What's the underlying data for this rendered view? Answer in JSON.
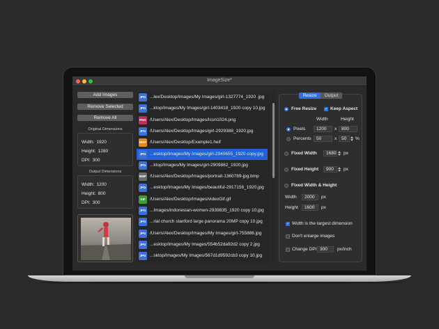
{
  "window": {
    "title": "ImageSize*"
  },
  "left": {
    "add_label": "Add Images",
    "remove_selected_label": "Remove Selected",
    "remove_all_label": "Remove All",
    "original": {
      "title": "Original Dimensions",
      "width_label": "Width:",
      "width": "1920",
      "height_label": "Height:",
      "height": "1280",
      "dpi_label": "DPI:",
      "dpi": "300"
    },
    "output": {
      "title": "Output Dimensions",
      "width_label": "Width:",
      "width": "1200",
      "height_label": "Height:",
      "height": "800",
      "dpi_label": "DPI:",
      "dpi": "300"
    }
  },
  "files": [
    {
      "type": "JPG",
      "color": "#3d6fd8",
      "name": "...lex/Desktop/Images/My Images/girl-1327774_1920 .jpg"
    },
    {
      "type": "JPG",
      "color": "#3d6fd8",
      "name": "...ktop/Images/My Images/girl-1403418_1920 copy 10.jpg"
    },
    {
      "type": "PNG",
      "color": "#b8305c",
      "name": "/Users/Alex/Desktop/Images/Icon1024.png"
    },
    {
      "type": "JPG",
      "color": "#3d6fd8",
      "name": "/Users/Alex/Desktop/Images/girl-2929388_1920.jpg"
    },
    {
      "type": "HEIF",
      "color": "#e58a1f",
      "name": "/Users/Alex/Desktop/Example1.heif"
    },
    {
      "type": "JPG",
      "color": "#3d6fd8",
      "name": "...esktop/Images/My Images/girl-2940655_1920 copy.jpg",
      "selected": true
    },
    {
      "type": "JPG",
      "color": "#3d6fd8",
      "name": "...ktop/Images/My Images/girl-2909862_1920.jpg"
    },
    {
      "type": "BMP",
      "color": "#6b6b6b",
      "name": "/Users/Alex/Desktop/Images/portrait-1360789-jpg.bmp"
    },
    {
      "type": "JPG",
      "color": "#3d6fd8",
      "name": "...esktop/Images/My Images/beautiful-2917156_1920.jpg"
    },
    {
      "type": "GIF",
      "color": "#3d9a3d",
      "name": "/Users/Alex/Desktop/Images/videoGif.gif"
    },
    {
      "type": "JPG",
      "color": "#3d6fd8",
      "name": "...Images/indonesian-women-2939835_1920 copy 10.jpg"
    },
    {
      "type": "JPG",
      "color": "#3d6fd8",
      "name": "...rial church stanford large panorama 20MP copy 10.jpg"
    },
    {
      "type": "JPG",
      "color": "#3d6fd8",
      "name": "/Users/Alex/Desktop/Images/My Images/girl-755888.jpg"
    },
    {
      "type": "JPG",
      "color": "#3d6fd8",
      "name": "...esktop/Images/My Images/554b52da92d2 copy 2.jpg"
    },
    {
      "type": "JPG",
      "color": "#3d6fd8",
      "name": "...sktop/Images/My Images/567d1d9592cb3 copy 10.jpg"
    }
  ],
  "panel": {
    "tab_resize": "Resize",
    "tab_output": "Output",
    "free_resize": "Free Resize",
    "keep_aspect": "Keep Aspect",
    "col_width": "Width",
    "col_height": "Height",
    "pixels": "Pixels",
    "pixels_w": "1200",
    "pixels_h": "800",
    "percents": "Percents",
    "percents_w": "50",
    "percents_h": "50",
    "x": "x",
    "pct": "%",
    "px": "px",
    "fixed_width": "Fixed Width",
    "fixed_width_value": "1680",
    "fixed_height": "Fixed Height",
    "fixed_height_value": "900",
    "fixed_wh": "Fixed Width & Height",
    "wh_width_label": "Width",
    "wh_width_value": "2000",
    "wh_height_label": "Height",
    "wh_height_value": "1600",
    "largest": "Width is the largest dimension",
    "dont_enlarge": "Don't enlarge images",
    "change_dpi": "Change DPI",
    "dpi_value": "300",
    "dpi_unit": "px/inch"
  },
  "colors": {
    "accent": "#2f6fe0",
    "selection": "#2262d6"
  }
}
